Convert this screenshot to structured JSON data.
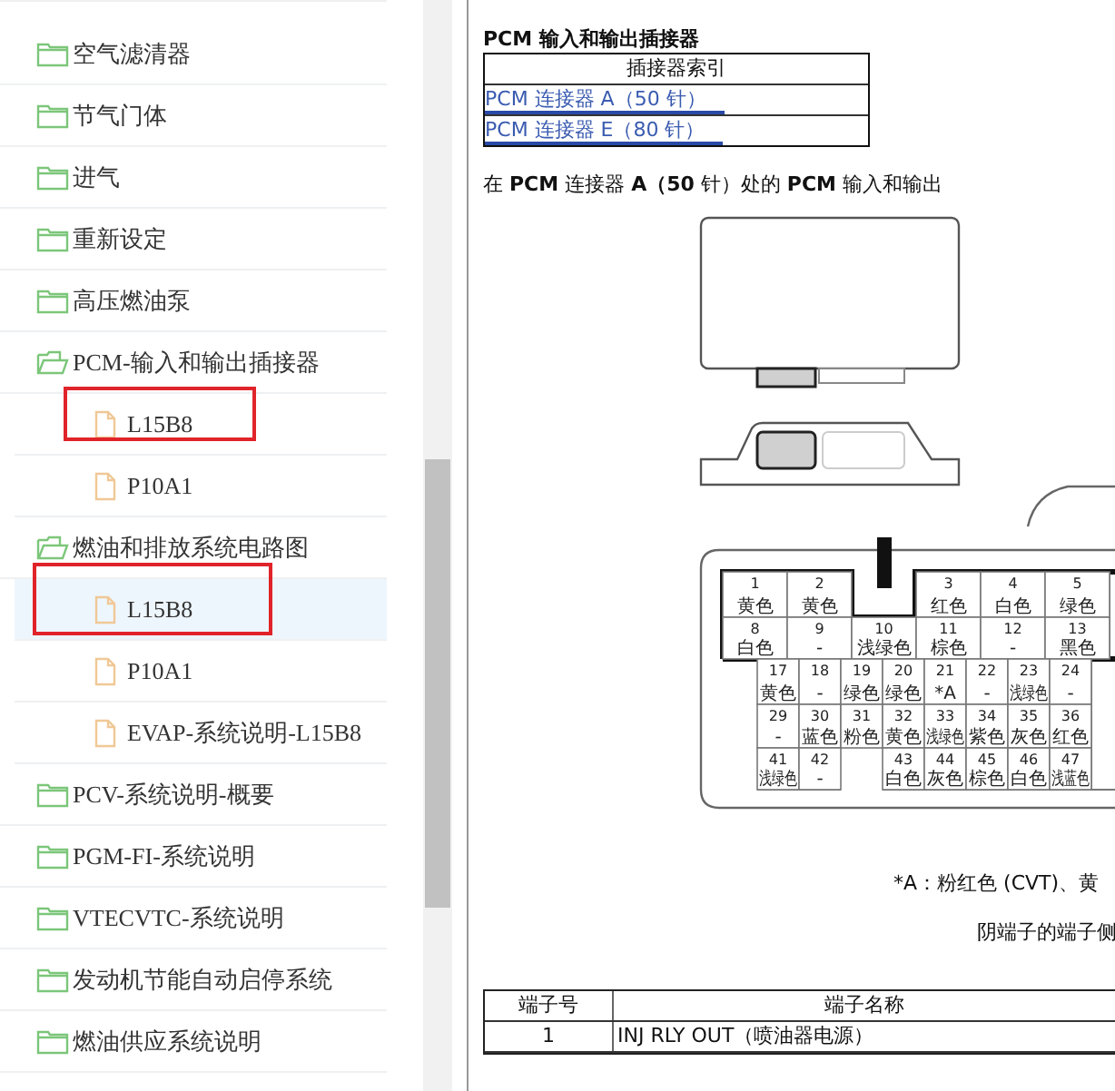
{
  "sidebar": {
    "items": [
      {
        "label": "空气滤清器",
        "expanded": false,
        "selected": false
      },
      {
        "label": "节气门体",
        "expanded": false,
        "selected": false
      },
      {
        "label": "进气",
        "expanded": false,
        "selected": false
      },
      {
        "label": "重新设定",
        "expanded": false,
        "selected": false
      },
      {
        "label": "高压燃油泵",
        "expanded": false,
        "selected": false
      },
      {
        "label": "PCM-输入和输出插接器",
        "expanded": true,
        "selected": false,
        "children": [
          {
            "label": "L15B8",
            "selected": false,
            "marked": true
          },
          {
            "label": "P10A1",
            "selected": false,
            "marked": false
          }
        ]
      },
      {
        "label": "燃油和排放系统电路图",
        "expanded": true,
        "selected": false,
        "children": [
          {
            "label": "L15B8",
            "selected": true,
            "marked": true
          },
          {
            "label": "P10A1",
            "selected": false,
            "marked": false
          },
          {
            "label": "EVAP-系统说明-L15B8",
            "selected": false,
            "marked": false
          }
        ]
      },
      {
        "label": "PCV-系统说明-概要",
        "expanded": false,
        "selected": false
      },
      {
        "label": "PGM-FI-系统说明",
        "expanded": false,
        "selected": false
      },
      {
        "label": "VTECVTC-系统说明",
        "expanded": false,
        "selected": false
      },
      {
        "label": "发动机节能自动启停系统",
        "expanded": false,
        "selected": false
      },
      {
        "label": "燃油供应系统说明",
        "expanded": false,
        "selected": false
      }
    ]
  },
  "document": {
    "heading": "PCM 输入和输出插接器",
    "index_table": {
      "header": "插接器索引",
      "links": [
        "PCM 连接器 A（50 针）",
        "PCM 连接器 E（80 针）"
      ]
    },
    "section_title": "在 **PCM** 连接器 **A（50** 针）处的 **PCM** 输入和输出",
    "connector_pins": [
      {
        "pins": [
          {
            "number": "1",
            "wire": "黄色"
          },
          {
            "number": "2",
            "wire": "黄色"
          },
          {
            "number": "3",
            "wire": "红色"
          },
          {
            "number": "4",
            "wire": "白色"
          },
          {
            "number": "5",
            "wire": "绿色"
          }
        ]
      },
      {
        "pins": [
          {
            "number": "8",
            "wire": "白色"
          },
          {
            "number": "9",
            "wire": "-"
          },
          {
            "number": "10",
            "wire": "浅绿色"
          },
          {
            "number": "11",
            "wire": "棕色"
          },
          {
            "number": "12",
            "wire": "-"
          },
          {
            "number": "13",
            "wire": "黑色"
          }
        ]
      },
      {
        "pins": [
          {
            "number": "17",
            "wire": "黄色"
          },
          {
            "number": "18",
            "wire": "-"
          },
          {
            "number": "19",
            "wire": "绿色"
          },
          {
            "number": "20",
            "wire": "绿色"
          },
          {
            "number": "21",
            "wire": "*A"
          },
          {
            "number": "22",
            "wire": "-"
          },
          {
            "number": "23",
            "wire": "浅绿色"
          },
          {
            "number": "24",
            "wire": "-"
          }
        ]
      },
      {
        "pins": [
          {
            "number": "29",
            "wire": "-"
          },
          {
            "number": "30",
            "wire": "蓝色"
          },
          {
            "number": "31",
            "wire": "粉色"
          },
          {
            "number": "32",
            "wire": "黄色"
          },
          {
            "number": "33",
            "wire": "浅绿色"
          },
          {
            "number": "34",
            "wire": "紫色"
          },
          {
            "number": "35",
            "wire": "灰色"
          },
          {
            "number": "36",
            "wire": "红色"
          }
        ]
      },
      {
        "pins": [
          {
            "number": "41",
            "wire": "浅绿色"
          },
          {
            "number": "42",
            "wire": "-"
          },
          {
            "number": "43",
            "wire": "白色"
          },
          {
            "number": "44",
            "wire": "灰色"
          },
          {
            "number": "45",
            "wire": "棕色"
          },
          {
            "number": "46",
            "wire": "白色"
          },
          {
            "number": "47",
            "wire": "浅蓝色"
          }
        ]
      }
    ],
    "footnote": "*A：粉红色 (CVT)、黄",
    "view_note": "阴端子的端子侧",
    "terminal_table": {
      "columns": [
        "端子号",
        "端子名称"
      ],
      "rows": [
        {
          "number": "1",
          "name": "INJ RLY OUT（喷油器电源）"
        }
      ]
    }
  }
}
